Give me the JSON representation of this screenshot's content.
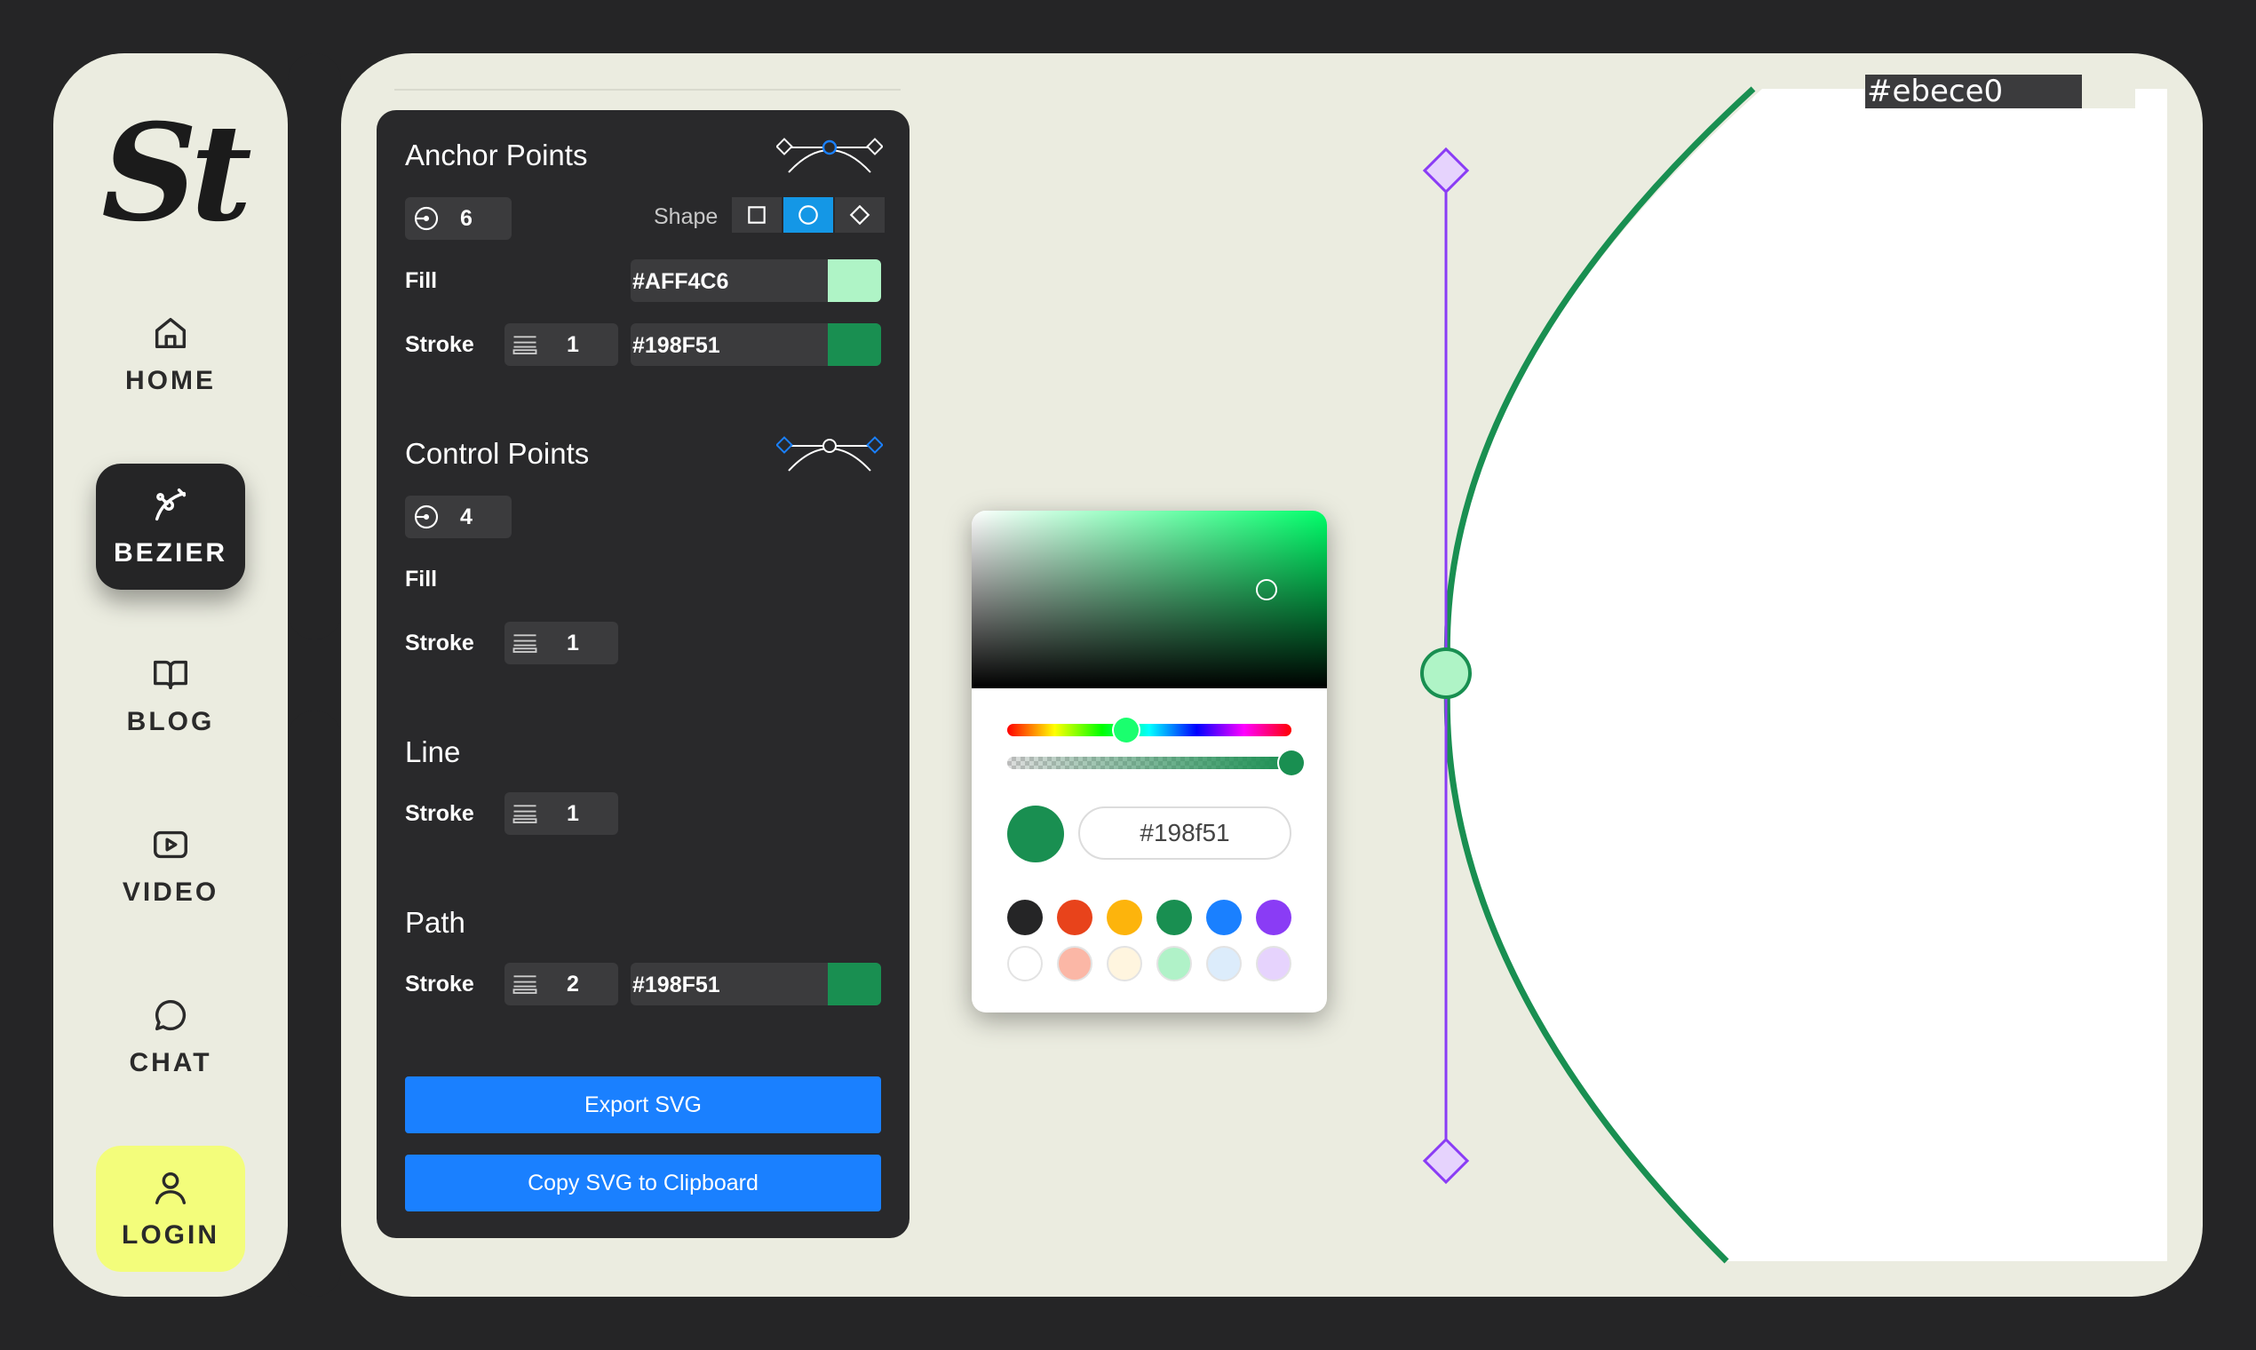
{
  "nav": {
    "logo": "St",
    "items": [
      {
        "label": "HOME",
        "icon": "home-icon"
      },
      {
        "label": "BEZIER",
        "icon": "bezier-icon",
        "active": true
      },
      {
        "label": "BLOG",
        "icon": "book-icon"
      },
      {
        "label": "VIDEO",
        "icon": "video-icon"
      },
      {
        "label": "CHAT",
        "icon": "chat-icon"
      },
      {
        "label": "LOGIN",
        "icon": "user-icon"
      }
    ]
  },
  "panel": {
    "anchor_points": {
      "title": "Anchor Points",
      "count": "6",
      "shape_label": "Shape",
      "shapes": [
        "square",
        "circle",
        "diamond"
      ],
      "selected_shape": "circle",
      "fill_label": "Fill",
      "fill_color": "#AFF4C6",
      "stroke_label": "Stroke",
      "stroke_width": "1",
      "stroke_color": "#198F51"
    },
    "control_points": {
      "title": "Control Points",
      "count": "4",
      "fill_label": "Fill",
      "stroke_label": "Stroke",
      "stroke_width": "1"
    },
    "line": {
      "title": "Line",
      "stroke_label": "Stroke",
      "stroke_width": "1"
    },
    "path": {
      "title": "Path",
      "stroke_label": "Stroke",
      "stroke_width": "2",
      "stroke_color": "#198F51"
    },
    "export_label": "Export SVG",
    "copy_label": "Copy SVG to Clipboard"
  },
  "picker": {
    "hex_value": "#198f51",
    "current_color": "#198f51",
    "hue_position": 0.41,
    "alpha": 1.0,
    "presets": [
      "#252526",
      "#e8431b",
      "#fdb40c",
      "#198f51",
      "#1a80ff",
      "#8a3cf5",
      "#ffffff",
      "#fbb7a6",
      "#fff5df",
      "#b0f2c8",
      "#dcecfb",
      "#e6d3fd"
    ]
  },
  "canvas": {
    "background_label": "#ebece0",
    "line_color": "#8a3cf5",
    "path_color": "#198f51",
    "anchor_fill": "#aff4c6",
    "handle_fill": "#e6d3fd"
  }
}
